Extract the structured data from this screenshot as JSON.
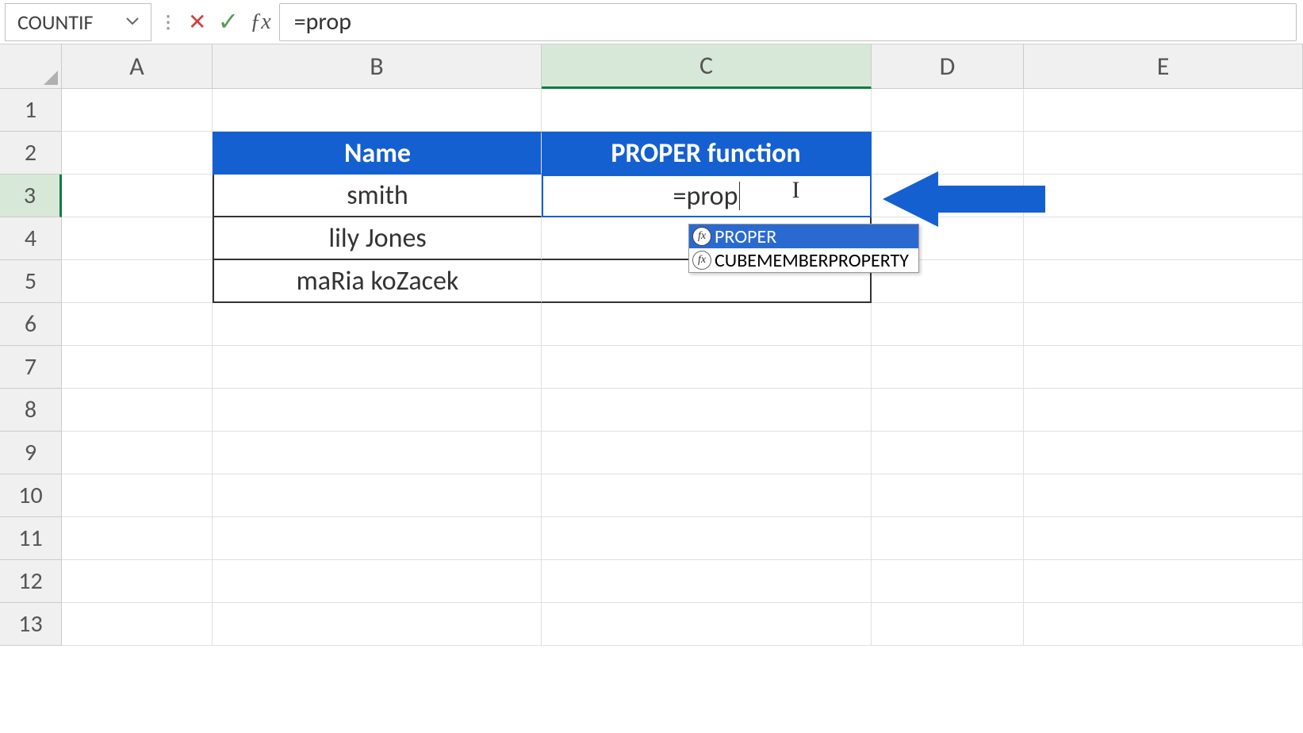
{
  "formulaBar": {
    "nameBox": "COUNTIF",
    "formula": "=prop"
  },
  "columns": [
    "A",
    "B",
    "C",
    "D",
    "E"
  ],
  "rows": [
    "1",
    "2",
    "3",
    "4",
    "5",
    "6",
    "7",
    "8",
    "9",
    "10",
    "11",
    "12",
    "13"
  ],
  "activeCell": "C3",
  "table": {
    "headers": {
      "B": "Name",
      "C": "PROPER function"
    },
    "data": {
      "B3": "smith",
      "B4": "lily Jones",
      "B5": "maRia koZacek",
      "C3": "=prop"
    }
  },
  "autocomplete": {
    "items": [
      {
        "label": "PROPER",
        "selected": true
      },
      {
        "label": "CUBEMEMBERPROPERTY",
        "selected": false
      }
    ]
  }
}
